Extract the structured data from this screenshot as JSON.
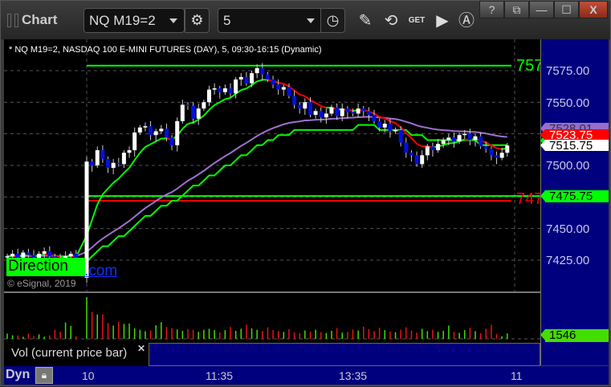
{
  "window": {
    "title": "Chart",
    "buttons": {
      "help": "?",
      "restore_down": "⧉",
      "minimize": "—",
      "maximize": "☐",
      "close": "X"
    }
  },
  "toolbar": {
    "symbol": "NQ M19=2",
    "interval": "5",
    "icons": [
      "settings-gear-icon",
      "clock-icon",
      "pencil-icon",
      "study-icon",
      "get-icon",
      "play-icon",
      "alert-icon"
    ],
    "get_label": "GET"
  },
  "chart": {
    "header": "* NQ M19=2, NASDAQ 100 E-MINI FUTURES (DAY), 5, 09:30-16:15 (Dynamic)",
    "price_labels": [
      "7575.00",
      "7550.00",
      "7500.00",
      "7450.00",
      "7425.00"
    ],
    "level_labels": {
      "upper": "757",
      "lower": "747"
    },
    "tags": {
      "purple": "7528.01",
      "red": "7523.75",
      "white": "7515.75",
      "green": "7475.75",
      "volume": "1546"
    },
    "watermark": {
      "brand": "Direction",
      "domain": ".com",
      "copyright": "© eSignal, 2019"
    },
    "volume_label": "Vol (current price bar)",
    "time_labels": [
      "10",
      "11:35",
      "13:35",
      "11"
    ],
    "footer_label": "Dyn",
    "colors": {
      "up": "#ffffff",
      "down": "#0010e0",
      "green": "#00ff00",
      "red": "#ff0000",
      "purple": "#a070d0",
      "axis": "#00007e"
    }
  },
  "chart_data": {
    "type": "candlestick",
    "title": "NQ M19=2, 5-minute",
    "prev_day_closes": [
      7428,
      7430,
      7427,
      7431,
      7429,
      7426,
      7430,
      7432,
      7428,
      7427,
      7424,
      7428,
      7430,
      7426
    ],
    "day_open": 7411,
    "closes": [
      7503,
      7500,
      7512,
      7505,
      7498,
      7502,
      7501,
      7510,
      7512,
      7526,
      7530,
      7531,
      7524,
      7527,
      7529,
      7522,
      7516,
      7535,
      7548,
      7547,
      7537,
      7545,
      7550,
      7560,
      7561,
      7558,
      7561,
      7557,
      7568,
      7570,
      7565,
      7573,
      7577,
      7572,
      7568,
      7564,
      7560,
      7562,
      7555,
      7548,
      7545,
      7550,
      7540,
      7543,
      7538,
      7541,
      7546,
      7539,
      7545,
      7542,
      7541,
      7545,
      7543,
      7540,
      7535,
      7530,
      7533,
      7527,
      7528,
      7518,
      7510,
      7508,
      7501,
      7508,
      7515,
      7512,
      7517,
      7520,
      7522,
      7519,
      7524,
      7525,
      7520,
      7523,
      7515,
      7513,
      7508,
      7506,
      7510,
      7515.75
    ],
    "prev_volumes": [
      1500,
      1000,
      1000,
      600,
      1500,
      800,
      1300,
      600,
      1000,
      2600,
      2000,
      4700,
      3700,
      700
    ],
    "volumes": [
      12000,
      7700,
      7000,
      7000,
      4500,
      3800,
      4900,
      4300,
      4400,
      3000,
      2600,
      2200,
      2400,
      3900,
      4800,
      3400,
      3000,
      2700,
      2300,
      2800,
      2600,
      2000,
      2600,
      2900,
      2500,
      1800,
      2500,
      3400,
      2300,
      2900,
      4100,
      3000,
      2600,
      2200,
      3300,
      2500,
      2200,
      2000,
      2800,
      1800,
      1600,
      2400,
      2100,
      2600,
      1900,
      1700,
      2300,
      3000,
      1800,
      2000,
      2700,
      2400,
      3500,
      2800,
      2200,
      3200,
      2500,
      2100,
      1900,
      2600,
      3300,
      2400,
      1800,
      2900,
      2200,
      2600,
      2000,
      2300,
      3800,
      2000,
      1700,
      2500,
      3200,
      2200,
      1600,
      2900,
      4000,
      1400,
      700,
      1546
    ],
    "levels": {
      "upper_green": 7579,
      "lower_green": 7475.75,
      "lower_red": 7472
    },
    "ylim": [
      7410,
      7590
    ]
  }
}
